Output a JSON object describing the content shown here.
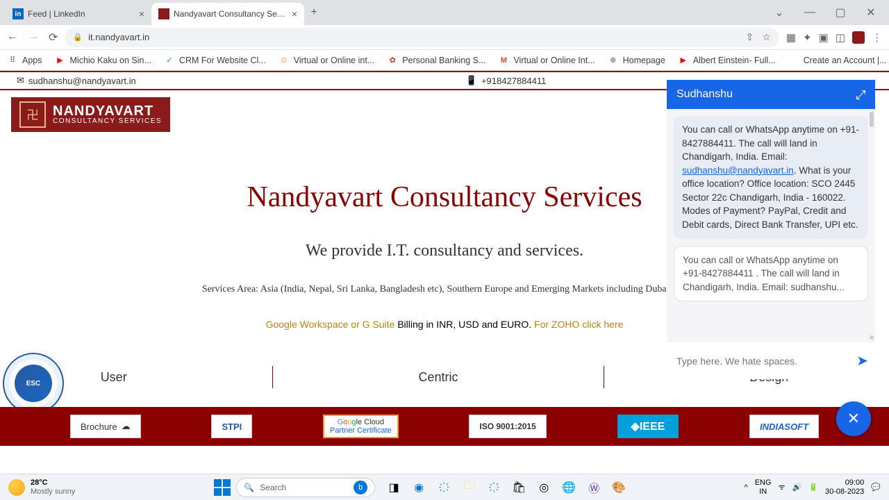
{
  "browser": {
    "tabs": [
      {
        "title": "Feed | LinkedIn",
        "favicon_bg": "#0a66c2",
        "favicon_text": "in"
      },
      {
        "title": "Nandyavart Consultancy Services",
        "favicon_bg": "#8b1a1a",
        "favicon_text": ""
      }
    ],
    "url": "it.nandyavart.in",
    "bookmarks": [
      {
        "label": "Apps",
        "icon": "⠿",
        "color": "#5f6368"
      },
      {
        "label": "Michio Kaku on Sin...",
        "icon": "▶",
        "color": "#ff0000"
      },
      {
        "label": "CRM For Website Cl...",
        "icon": "✓",
        "color": "#00a1e0"
      },
      {
        "label": "Virtual or Online int...",
        "icon": "⊙",
        "color": "#f5a623"
      },
      {
        "label": "Personal Banking S...",
        "icon": "✿",
        "color": "#d32f2f"
      },
      {
        "label": "Virtual or Online Int...",
        "icon": "M",
        "color": "#ea4335"
      },
      {
        "label": "Homepage",
        "icon": "⊕",
        "color": "#5f6368"
      },
      {
        "label": "Albert Einstein- Full...",
        "icon": "▶",
        "color": "#ff0000"
      },
      {
        "label": "Create an Account |...",
        "icon": "",
        "color": "#5f6368"
      }
    ]
  },
  "page": {
    "email": "sudhanshu@nandyavart.in",
    "phone": "+918427884411",
    "logo": {
      "title": "NANDYAVART",
      "subtitle": "CONSULTANCY SERVICES"
    },
    "hero_title": "Nandyavart Consultancy Services",
    "hero_sub": "We provide I.T. consultancy and services.",
    "services_area": "Services Area: Asia (India, Nepal, Sri Lanka, Bangladesh etc), Southern Europe and Emerging Markets including Dubai, Afr",
    "link1": "Google Workspace or G Suite",
    "billing": " Billing in INR, USD and EURO. ",
    "link2": "For ZOHO click here",
    "triad": [
      "User",
      "Centric",
      "Design"
    ],
    "badges": {
      "brochure": "Brochure",
      "stpi": "STPI",
      "gcloud_top": "Google Cloud",
      "gcloud_bottom": "Partner Certificate",
      "iso": "ISO 9001:2015",
      "ieee": "◈IEEE",
      "indiasoft": "INDIASOFT"
    }
  },
  "chat": {
    "title": "Sudhanshu",
    "msg1_text_pre": "You can call or WhatsApp anytime on +91-8427884411. The call will land in Chandigarh, India. Email: ",
    "msg1_link": "sudhanshu@nandyavart.in",
    "msg1_text_post": ". What is your office location? Office location: SCO 2445 Sector 22c Chandigarh, India - 160022. Modes of Payment? PayPal, Credit and Debit cards, Direct Bank Transfer, UPI etc.",
    "msg2": "You can call or WhatsApp anytime on +91-8427884411 . The call will land in Chandigarh, India. Email: sudhanshu...",
    "input_placeholder": "Type here. We hate spaces."
  },
  "taskbar": {
    "temp": "28°C",
    "condition": "Mostly sunny",
    "search_placeholder": "Search",
    "lang1": "ENG",
    "lang2": "IN",
    "time": "09:00",
    "date": "30-08-2023"
  }
}
